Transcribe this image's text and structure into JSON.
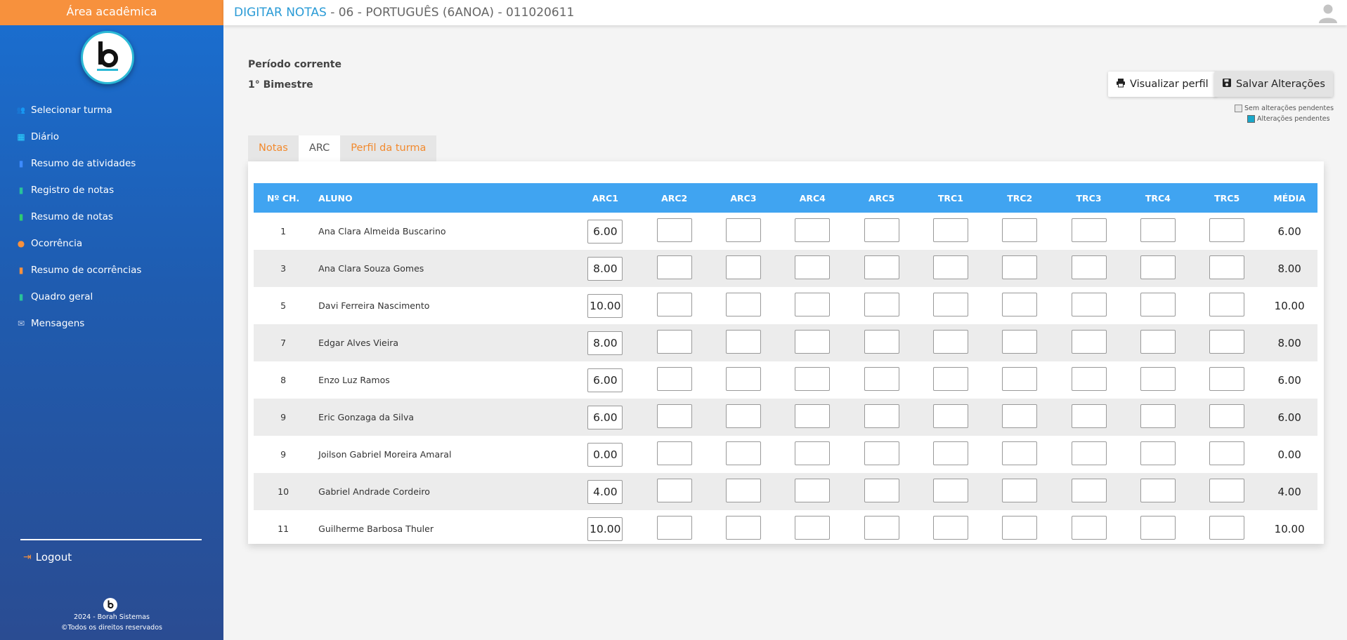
{
  "sidebar": {
    "header": "Área acadêmica",
    "items": [
      {
        "label": "Selecionar turma",
        "icon": "users-icon",
        "color": "#f7913d"
      },
      {
        "label": "Diário",
        "icon": "calendar-icon",
        "color": "#2bd4ff"
      },
      {
        "label": "Resumo de atividades",
        "icon": "document-icon",
        "color": "#3d8bff"
      },
      {
        "label": "Registro de notas",
        "icon": "edit-document-icon",
        "color": "#29c29a"
      },
      {
        "label": "Resumo de notas",
        "icon": "document-icon",
        "color": "#2ecc71"
      },
      {
        "label": "Ocorrência",
        "icon": "info-icon",
        "color": "#f7913d"
      },
      {
        "label": "Resumo de ocorrências",
        "icon": "document-icon",
        "color": "#f7913d"
      },
      {
        "label": "Quadro geral",
        "icon": "clipboard-icon",
        "color": "#29c29a"
      },
      {
        "label": "Mensagens",
        "icon": "envelope-icon",
        "color": "#b8c9e6"
      }
    ],
    "logout": "Logout",
    "footer_line1": "2024 - Borah Sistemas",
    "footer_line2": "©Todos os direitos reservados"
  },
  "topbar": {
    "title_highlight": "DIGITAR NOTAS",
    "title_rest": " - 06 - PORTUGUÊS (6ANOA) - 011020611"
  },
  "period": {
    "label": "Período corrente",
    "value": "1° Bimestre"
  },
  "buttons": {
    "view_profile": "Visualizar perfil",
    "save_changes": "Salvar Alterações"
  },
  "legend": {
    "no_pending": "Sem alterações pendentes",
    "pending": "Alterações pendentes"
  },
  "tabs": [
    {
      "label": "Notas",
      "active": false
    },
    {
      "label": "ARC",
      "active": true
    },
    {
      "label": "Perfil da turma",
      "active": false
    }
  ],
  "table": {
    "headers": [
      "Nº CH.",
      "ALUNO",
      "ARC1",
      "ARC2",
      "ARC3",
      "ARC4",
      "ARC5",
      "TRC1",
      "TRC2",
      "TRC3",
      "TRC4",
      "TRC5",
      "MÉDIA"
    ],
    "rows": [
      {
        "num": "1",
        "name": "Ana Clara Almeida Buscarino",
        "grades": [
          "6.00",
          "",
          "",
          "",
          "",
          "",
          "",
          "",
          "",
          ""
        ],
        "media": "6.00"
      },
      {
        "num": "3",
        "name": "Ana Clara Souza Gomes",
        "grades": [
          "8.00",
          "",
          "",
          "",
          "",
          "",
          "",
          "",
          "",
          ""
        ],
        "media": "8.00"
      },
      {
        "num": "5",
        "name": "Davi Ferreira Nascimento",
        "grades": [
          "10.00",
          "",
          "",
          "",
          "",
          "",
          "",
          "",
          "",
          ""
        ],
        "media": "10.00"
      },
      {
        "num": "7",
        "name": "Edgar Alves Vieira",
        "grades": [
          "8.00",
          "",
          "",
          "",
          "",
          "",
          "",
          "",
          "",
          ""
        ],
        "media": "8.00"
      },
      {
        "num": "8",
        "name": "Enzo Luz Ramos",
        "grades": [
          "6.00",
          "",
          "",
          "",
          "",
          "",
          "",
          "",
          "",
          ""
        ],
        "media": "6.00"
      },
      {
        "num": "9",
        "name": "Eric Gonzaga da Silva",
        "grades": [
          "6.00",
          "",
          "",
          "",
          "",
          "",
          "",
          "",
          "",
          ""
        ],
        "media": "6.00"
      },
      {
        "num": "9",
        "name": "Joilson Gabriel Moreira Amaral",
        "grades": [
          "0.00",
          "",
          "",
          "",
          "",
          "",
          "",
          "",
          "",
          ""
        ],
        "media": "0.00"
      },
      {
        "num": "10",
        "name": "Gabriel Andrade Cordeiro",
        "grades": [
          "4.00",
          "",
          "",
          "",
          "",
          "",
          "",
          "",
          "",
          ""
        ],
        "media": "4.00"
      },
      {
        "num": "11",
        "name": "Guilherme Barbosa Thuler",
        "grades": [
          "10.00",
          "",
          "",
          "",
          "",
          "",
          "",
          "",
          "",
          ""
        ],
        "media": "10.00"
      }
    ]
  },
  "colors": {
    "accent_orange": "#f7913d",
    "header_blue": "#40a4f1",
    "title_blue": "#2a9bd6",
    "pending_teal": "#1aa7c9"
  }
}
